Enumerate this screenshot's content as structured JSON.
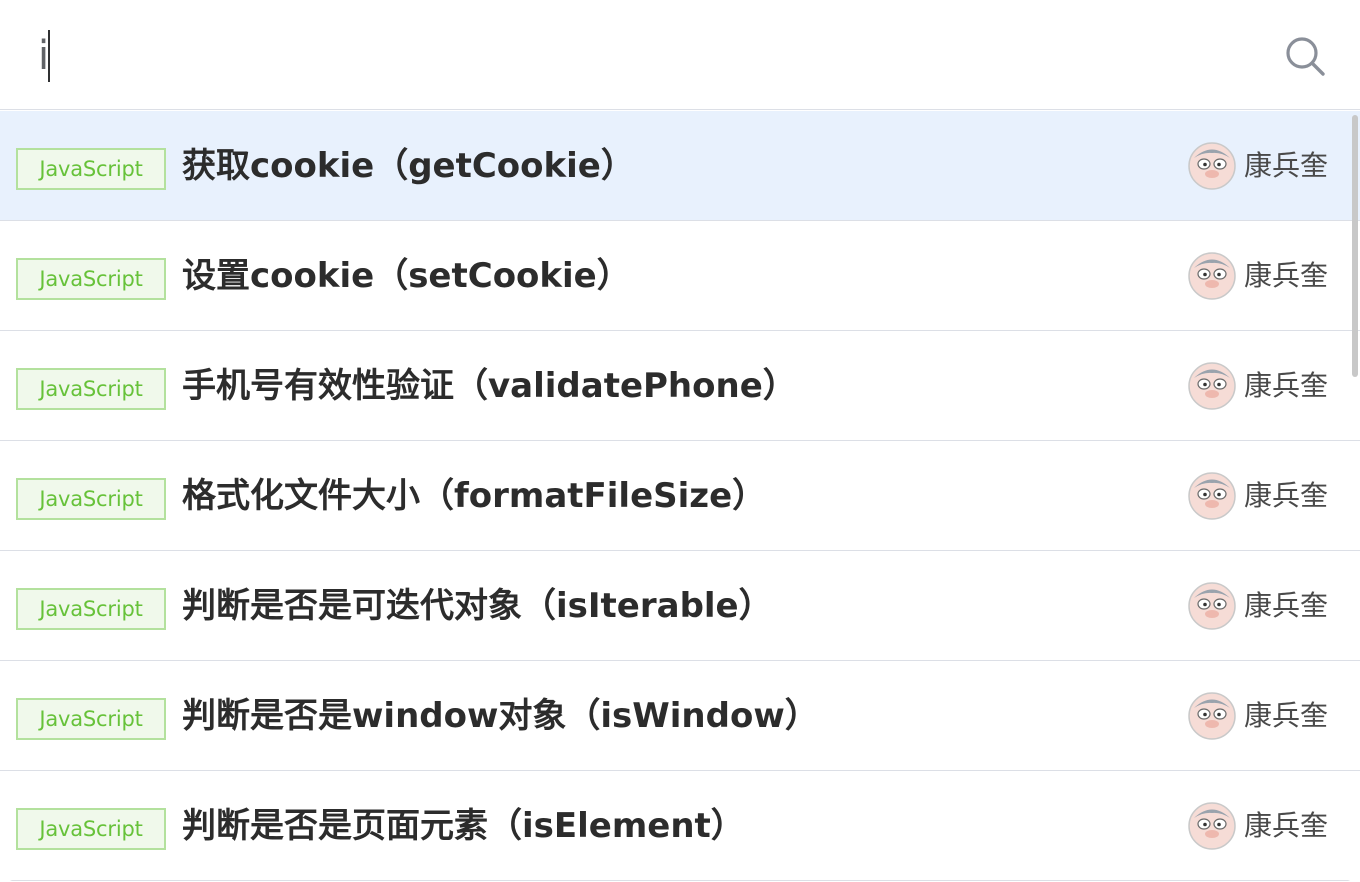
{
  "search": {
    "value": "i",
    "placeholder": ""
  },
  "results": [
    {
      "tag": "JavaScript",
      "title": "获取cookie（getCookie）",
      "author": "康兵奎"
    },
    {
      "tag": "JavaScript",
      "title": "设置cookie（setCookie）",
      "author": "康兵奎"
    },
    {
      "tag": "JavaScript",
      "title": "手机号有效性验证（validatePhone）",
      "author": "康兵奎"
    },
    {
      "tag": "JavaScript",
      "title": "格式化文件大小（formatFileSize）",
      "author": "康兵奎"
    },
    {
      "tag": "JavaScript",
      "title": "判断是否是可迭代对象（isIterable）",
      "author": "康兵奎"
    },
    {
      "tag": "JavaScript",
      "title": "判断是否是window对象（isWindow）",
      "author": "康兵奎"
    },
    {
      "tag": "JavaScript",
      "title": "判断是否是页面元素（isElement）",
      "author": "康兵奎"
    }
  ],
  "colors": {
    "highlight_row": "#e8f1fd",
    "tag_border": "#b3e19d",
    "tag_text": "#67c23a",
    "divider": "#dcdfe6"
  },
  "icons": {
    "search": "search-icon",
    "avatar": "avatar-icon"
  }
}
